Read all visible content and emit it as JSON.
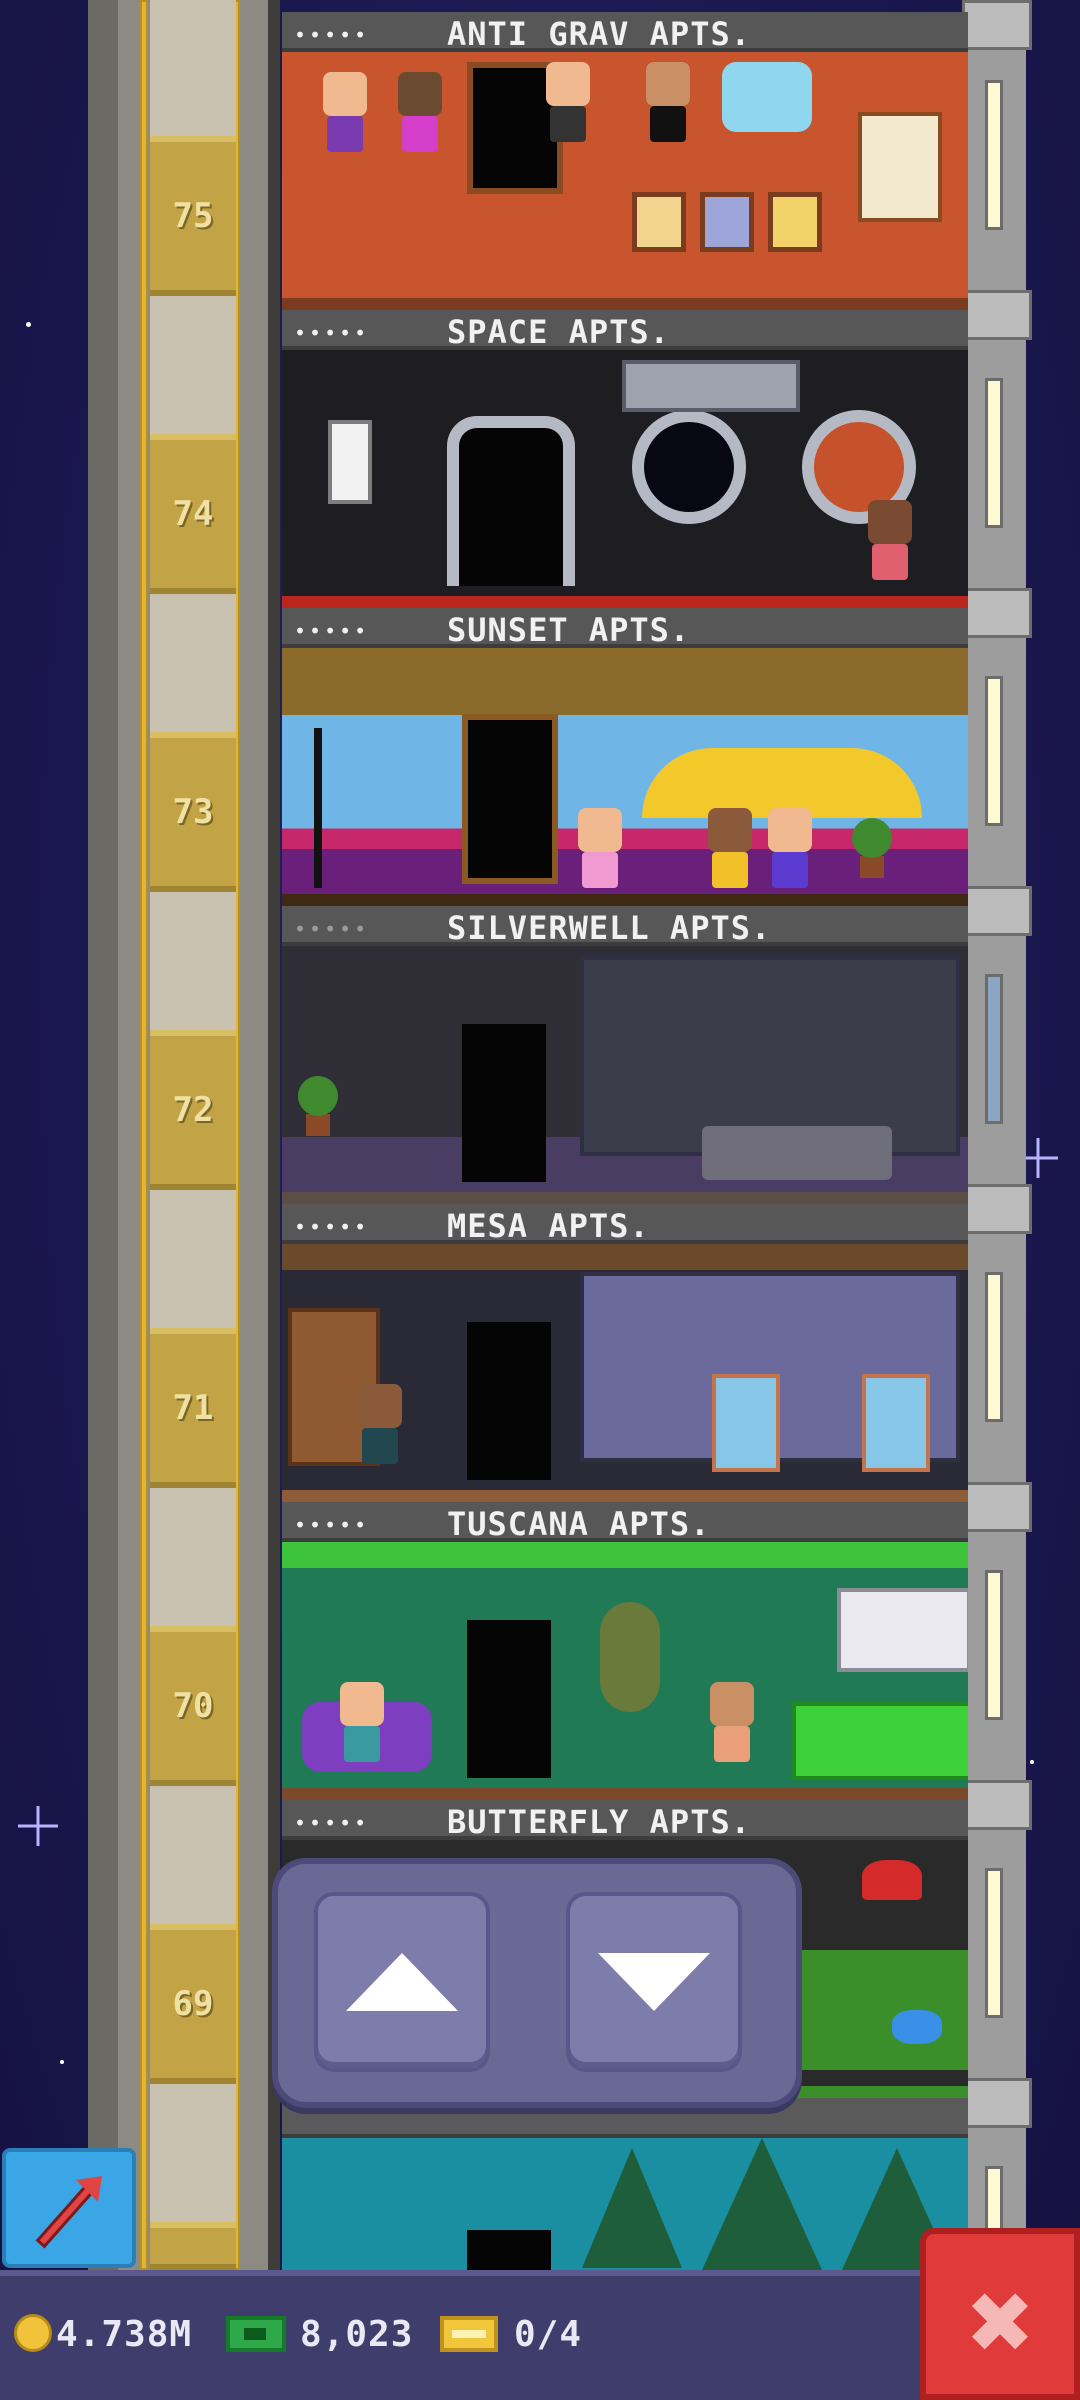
{
  "floors": [
    {
      "number": "75",
      "name": "ANTI GRAV APTS.",
      "occupants": "•••••",
      "theme": "#c9552e",
      "floor_color": "#7a3b1f"
    },
    {
      "number": "74",
      "name": "SPACE APTS.",
      "occupants": "•••••",
      "theme": "#1e1e22",
      "floor_color": "#b8261c"
    },
    {
      "number": "73",
      "name": "SUNSET APTS.",
      "occupants": "•••••",
      "theme": "#6fb6e7",
      "floor_color": "#3e2a14"
    },
    {
      "number": "72",
      "name": "SILVERWELL APTS.",
      "occupants": "•••••",
      "theme": "#2f2e36",
      "floor_color": "#5b4e44"
    },
    {
      "number": "71",
      "name": "MESA APTS.",
      "occupants": "•••••",
      "theme": "#2a2936",
      "floor_color": "#8f5c3a"
    },
    {
      "number": "70",
      "name": "TUSCANA APTS.",
      "occupants": "•••••",
      "theme": "#1f7a55",
      "floor_color": "#7a4a2b"
    },
    {
      "number": "69",
      "name": "BUTTERFLY APTS.",
      "occupants": "•••••",
      "theme": "#2a2a2a",
      "floor_color": "#3a8f2a"
    }
  ],
  "elevator_control": {
    "up_icon": "arrow-up-icon",
    "down_icon": "arrow-down-icon"
  },
  "status_bar": {
    "coins": "4.738M",
    "bux": "8,023",
    "tickets": "0/4"
  },
  "icons": {
    "share": "share-arrow-icon",
    "close": "close-icon",
    "close_glyph": "✖"
  }
}
